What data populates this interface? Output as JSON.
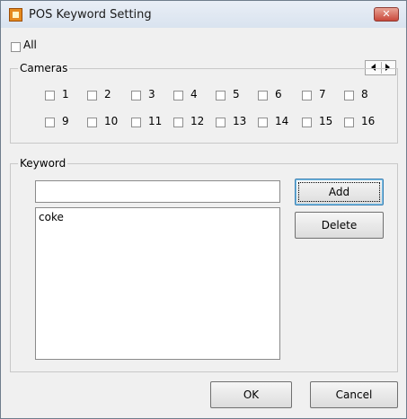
{
  "window": {
    "title": "POS Keyword Setting"
  },
  "all_checkbox": {
    "label": "All",
    "checked": false
  },
  "cameras": {
    "group_title": "Cameras",
    "items": [
      {
        "label": "1",
        "checked": false
      },
      {
        "label": "2",
        "checked": false
      },
      {
        "label": "3",
        "checked": false
      },
      {
        "label": "4",
        "checked": false
      },
      {
        "label": "5",
        "checked": false
      },
      {
        "label": "6",
        "checked": false
      },
      {
        "label": "7",
        "checked": false
      },
      {
        "label": "8",
        "checked": false
      },
      {
        "label": "9",
        "checked": false
      },
      {
        "label": "10",
        "checked": false
      },
      {
        "label": "11",
        "checked": false
      },
      {
        "label": "12",
        "checked": false
      },
      {
        "label": "13",
        "checked": false
      },
      {
        "label": "14",
        "checked": false
      },
      {
        "label": "15",
        "checked": false
      },
      {
        "label": "16",
        "checked": false
      }
    ]
  },
  "keyword": {
    "group_title": "Keyword",
    "input_value": "",
    "add_label": "Add",
    "delete_label": "Delete",
    "list": [
      "coke"
    ]
  },
  "footer": {
    "ok_label": "OK",
    "cancel_label": "Cancel"
  },
  "icons": {
    "app": "app-icon",
    "close": "close-icon",
    "left": "arrow-left-icon",
    "right": "arrow-right-icon"
  }
}
